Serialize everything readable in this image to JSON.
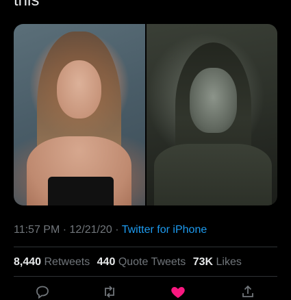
{
  "tweet": {
    "text": "this"
  },
  "meta": {
    "time": "11:57 PM",
    "separator": " · ",
    "date": "12/21/20",
    "source": "Twitter for iPhone"
  },
  "stats": {
    "retweets_count": "8,440",
    "retweets_label": "Retweets",
    "quotes_count": "440",
    "quotes_label": "Quote Tweets",
    "likes_count": "73K",
    "likes_label": "Likes"
  },
  "actions": {
    "icons": [
      "reply-icon",
      "retweet-icon",
      "like-icon",
      "share-icon"
    ],
    "like_color": "#f91880",
    "icon_color": "#71767b"
  },
  "colors": {
    "background": "#000000",
    "link": "#1d9bf0",
    "muted": "#71767b",
    "text": "#e7e9ea"
  }
}
